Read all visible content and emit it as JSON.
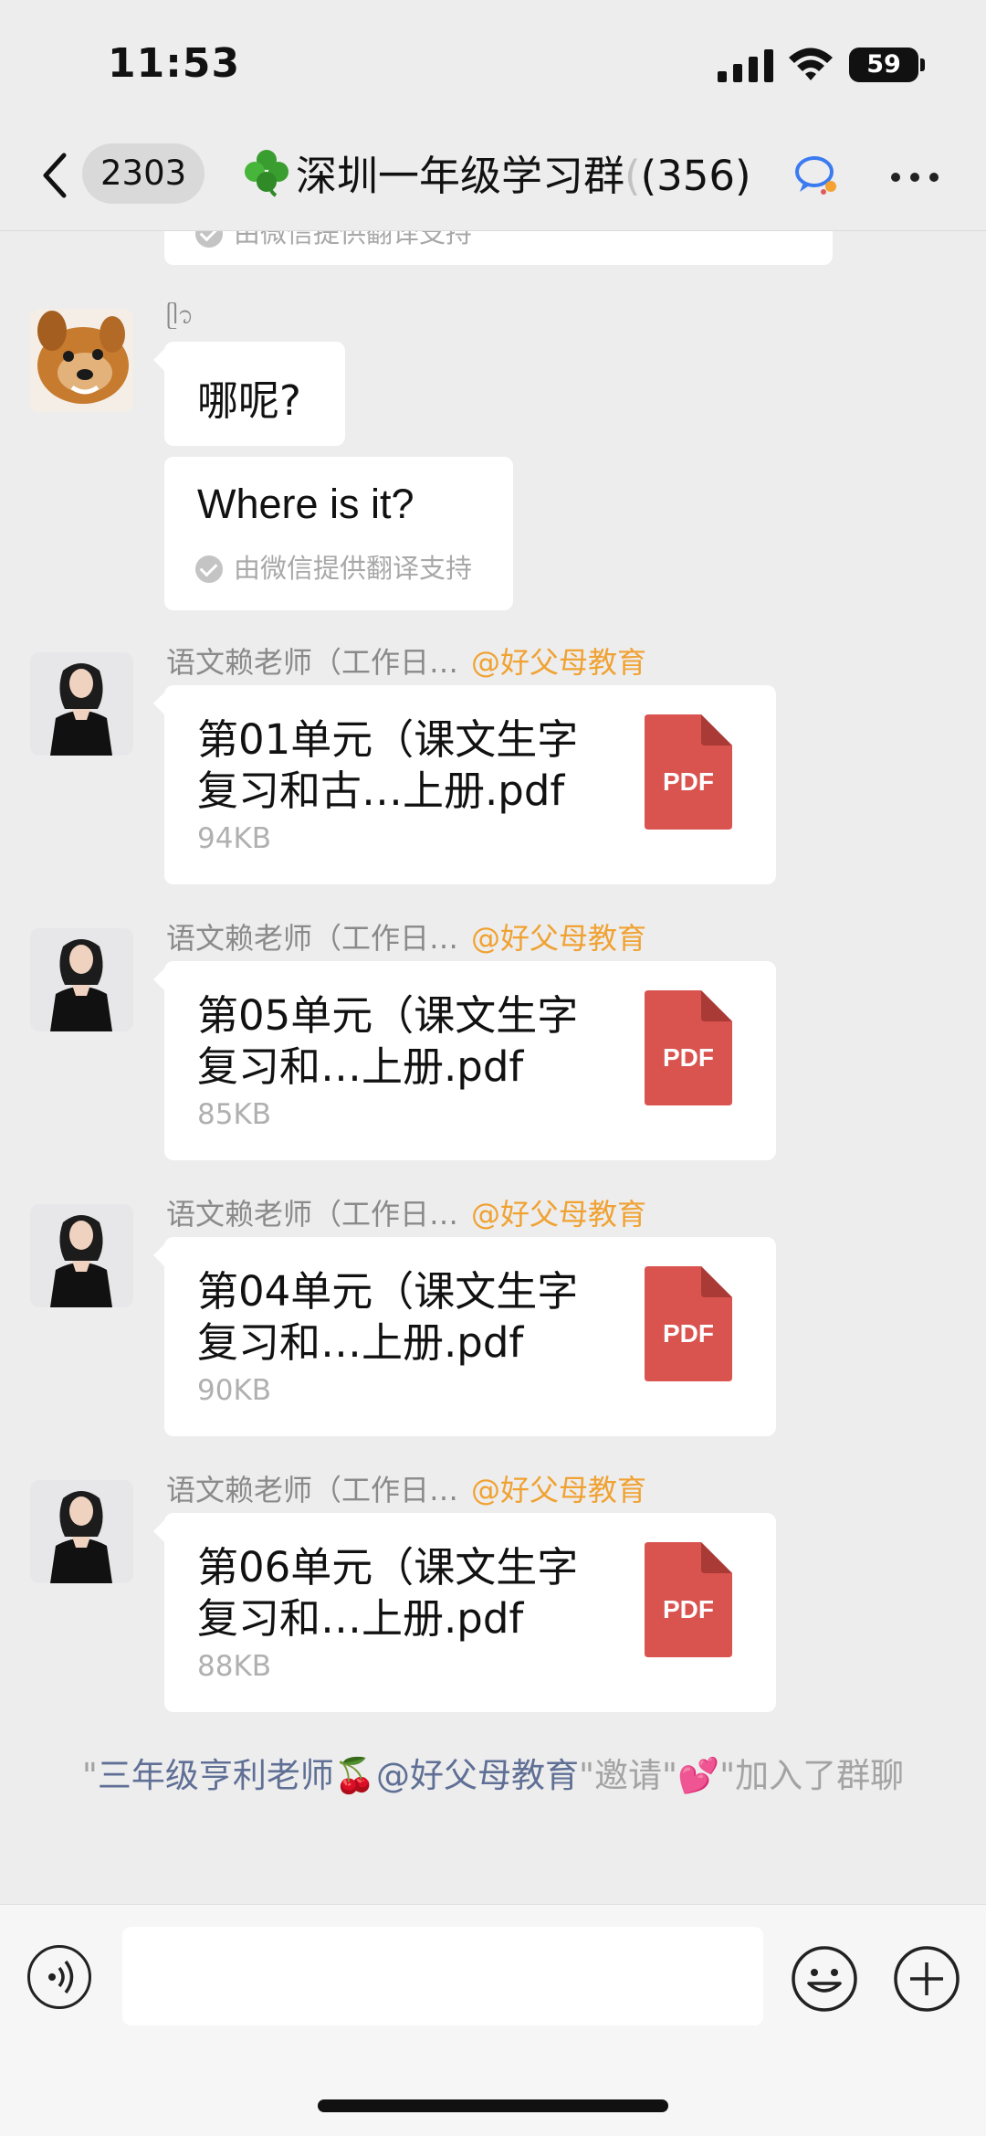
{
  "status_bar": {
    "time": "11:53",
    "battery": "59",
    "icons": [
      "signal-bars-icon",
      "wifi-icon",
      "battery-icon"
    ]
  },
  "nav": {
    "unread_count": "2303",
    "title_emoji": "clover-icon",
    "title_text": "深圳一年级学习群",
    "title_tail": "(",
    "member_count": "(356)",
    "icons": [
      "back-chevron-icon",
      "translate-bubble-icon",
      "more-dots-icon"
    ]
  },
  "messages": {
    "top_partial_note": "由微信提供翻译支持",
    "m1": {
      "sender": "ᥫ᭡",
      "text": "哪呢?",
      "translation": "Where is it?",
      "translation_note": "由微信提供翻译支持"
    },
    "files": [
      {
        "sender": "语文赖老师（工作日…",
        "tag": "@好父母教育",
        "name": "第01单元（课文生字复习和古…上册.pdf",
        "size": "94KB",
        "type": "PDF"
      },
      {
        "sender": "语文赖老师（工作日…",
        "tag": "@好父母教育",
        "name": "第05单元（课文生字复习和…上册.pdf",
        "size": "85KB",
        "type": "PDF"
      },
      {
        "sender": "语文赖老师（工作日…",
        "tag": "@好父母教育",
        "name": "第04单元（课文生字复习和…上册.pdf",
        "size": "90KB",
        "type": "PDF"
      },
      {
        "sender": "语文赖老师（工作日…",
        "tag": "@好父母教育",
        "name": "第06单元（课文生字复习和…上册.pdf",
        "size": "88KB",
        "type": "PDF"
      }
    ],
    "system": {
      "quote_open": "\"",
      "inviter": "三年级亨利老师🍒@好父母教育",
      "mid": "\"邀请\"",
      "emoji": "💕",
      "tail": "\"加入了群聊"
    }
  },
  "input": {
    "placeholder": "",
    "icons": [
      "voice-icon",
      "emoji-icon",
      "plus-icon"
    ]
  }
}
